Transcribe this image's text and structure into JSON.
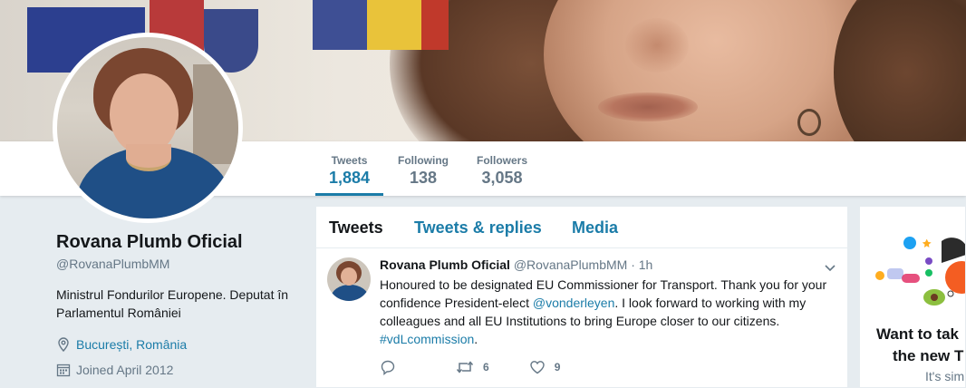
{
  "banner": {
    "alt": ""
  },
  "nav": {
    "items": [
      {
        "label": "Tweets",
        "value": "1,884",
        "active": true
      },
      {
        "label": "Following",
        "value": "138",
        "active": false
      },
      {
        "label": "Followers",
        "value": "3,058",
        "active": false
      }
    ]
  },
  "profile": {
    "name": "Rovana Plumb Oficial",
    "handle": "@RovanaPlumbMM",
    "bio": "Ministrul Fondurilor Europene. Deputat în Parlamentul României",
    "location": "București, România",
    "joined": "Joined April 2012"
  },
  "tabs": [
    {
      "label": "Tweets",
      "active": true
    },
    {
      "label": "Tweets & replies",
      "active": false
    },
    {
      "label": "Media",
      "active": false
    }
  ],
  "tweet": {
    "name": "Rovana Plumb Oficial",
    "handle": "@RovanaPlumbMM",
    "dot": "·",
    "time": "1h",
    "text_1": "Honoured to be designated  EU Commissioner for Transport. Thank you for your confidence President-elect ",
    "mention": "@vonderleyen",
    "text_2": ". I look forward to working with my colleagues and all EU Institutions to bring Europe closer to our citizens. ",
    "hashtag": "#vdLcommission",
    "text_3": ".",
    "retweets": "6",
    "likes": "9",
    "icons": {
      "reply": "reply-icon",
      "retweet": "retweet-icon",
      "like": "heart-icon",
      "more": "chevron-down-icon"
    }
  },
  "right_card": {
    "title": "Want to take the new T",
    "title_line1": "Want to tak",
    "title_line2": "the new T",
    "subtitle": "It's sim"
  },
  "colors": {
    "accent": "#1b7ca8",
    "muted": "#657786",
    "background": "#e6ecf0"
  }
}
